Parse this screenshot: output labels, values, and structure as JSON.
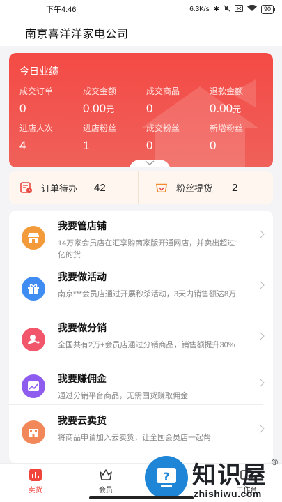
{
  "status_bar": {
    "time": "下午4:46",
    "net_speed": "6.3K/s",
    "battery": "90"
  },
  "header": {
    "store_name": "南京喜洋洋家电公司"
  },
  "performance": {
    "title": "今日业绩",
    "stats": [
      {
        "label": "成交订单",
        "value": "0",
        "unit": ""
      },
      {
        "label": "成交金额",
        "value": "0.00",
        "unit": "元"
      },
      {
        "label": "成交商品",
        "value": "0",
        "unit": ""
      },
      {
        "label": "退款金额",
        "value": "0.00",
        "unit": "元"
      },
      {
        "label": "进店人次",
        "value": "4",
        "unit": ""
      },
      {
        "label": "进店粉丝",
        "value": "1",
        "unit": ""
      },
      {
        "label": "成交粉丝",
        "value": "0",
        "unit": ""
      },
      {
        "label": "新增粉丝",
        "value": "0",
        "unit": ""
      }
    ]
  },
  "summary": {
    "orders_pending": {
      "label": "订单待办",
      "count": "42"
    },
    "fan_pickup": {
      "label": "粉丝提货",
      "count": "2"
    }
  },
  "features": [
    {
      "title": "我要管店铺",
      "desc": "14万家会员店在汇享购商家版开通网店，并卖出超过1亿的货",
      "icon": "store-icon",
      "color": "#f39a3a"
    },
    {
      "title": "我要做活动",
      "desc": "南京***会员店通过开展秒杀活动，3天内销售额达8万",
      "icon": "gift-icon",
      "color": "#3f8cf3"
    },
    {
      "title": "我要做分销",
      "desc": "全国共有2万+会员店通过分销商品，销售额提升30%",
      "icon": "user-share-icon",
      "color": "#f2566a"
    },
    {
      "title": "我要赚佣金",
      "desc": "通过分销平台商品，无需囤货赚取佣金",
      "icon": "chart-icon",
      "color": "#8f5cf0"
    },
    {
      "title": "我要云卖货",
      "desc": "将商品申请加入云卖货，让全国会员店一起帮",
      "icon": "building-icon",
      "color": "#f2885a"
    }
  ],
  "tabbar": {
    "tabs": [
      {
        "label": "卖货",
        "active": true
      },
      {
        "label": "会员",
        "active": false
      },
      {
        "label": "",
        "active": false
      },
      {
        "label": "工作台",
        "active": false
      }
    ]
  },
  "watermark": {
    "text": "知识屋",
    "url": "zhishiwu.com",
    "reg": "®"
  },
  "colors": {
    "accent": "#f0453d",
    "card_bg": "#f44a45",
    "summary_bg": "#fff7ef"
  }
}
